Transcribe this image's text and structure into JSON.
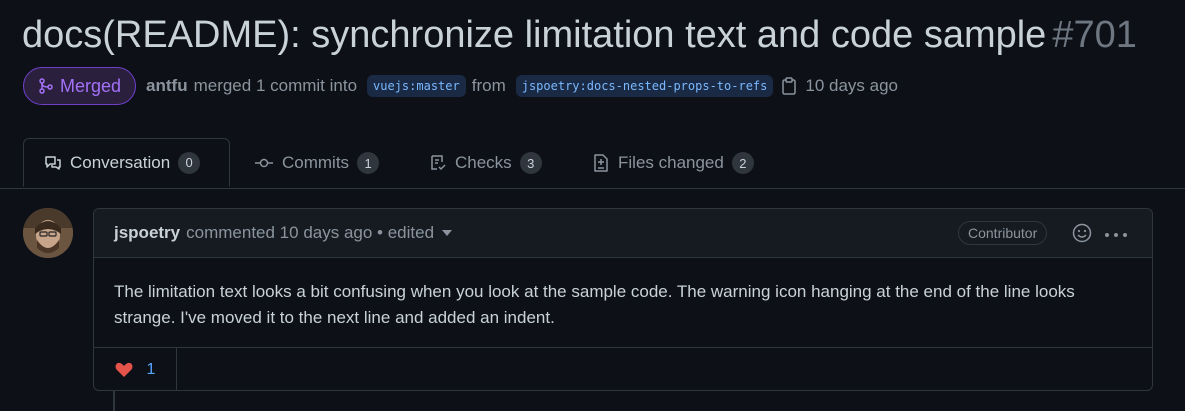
{
  "pr": {
    "title": "docs(README): synchronize limitation text and code sample",
    "number": "#701",
    "status": "Merged",
    "author": "antfu",
    "action": "merged 1 commit into",
    "base_branch": "vuejs:master",
    "from_text": "from",
    "head_branch": "jspoetry:docs-nested-props-to-refs",
    "time": "10 days ago"
  },
  "tabs": [
    {
      "label": "Conversation",
      "count": "0",
      "icon": "comment-discussion-icon"
    },
    {
      "label": "Commits",
      "count": "1",
      "icon": "git-commit-icon"
    },
    {
      "label": "Checks",
      "count": "3",
      "icon": "checklist-icon"
    },
    {
      "label": "Files changed",
      "count": "2",
      "icon": "file-diff-icon"
    }
  ],
  "comment": {
    "user": "jspoetry",
    "meta": "commented 10 days ago • edited",
    "role": "Contributor",
    "body": "The limitation text looks a bit confusing when you look at the sample code. The warning icon hanging at the end of the line looks strange. I've moved it to the next line and added an indent.",
    "reaction_count": "1"
  },
  "colors": {
    "background": "#0d1117",
    "merged_purple": "#a371f7",
    "link_blue": "#58a6ff",
    "heart_red": "#e5534b"
  }
}
